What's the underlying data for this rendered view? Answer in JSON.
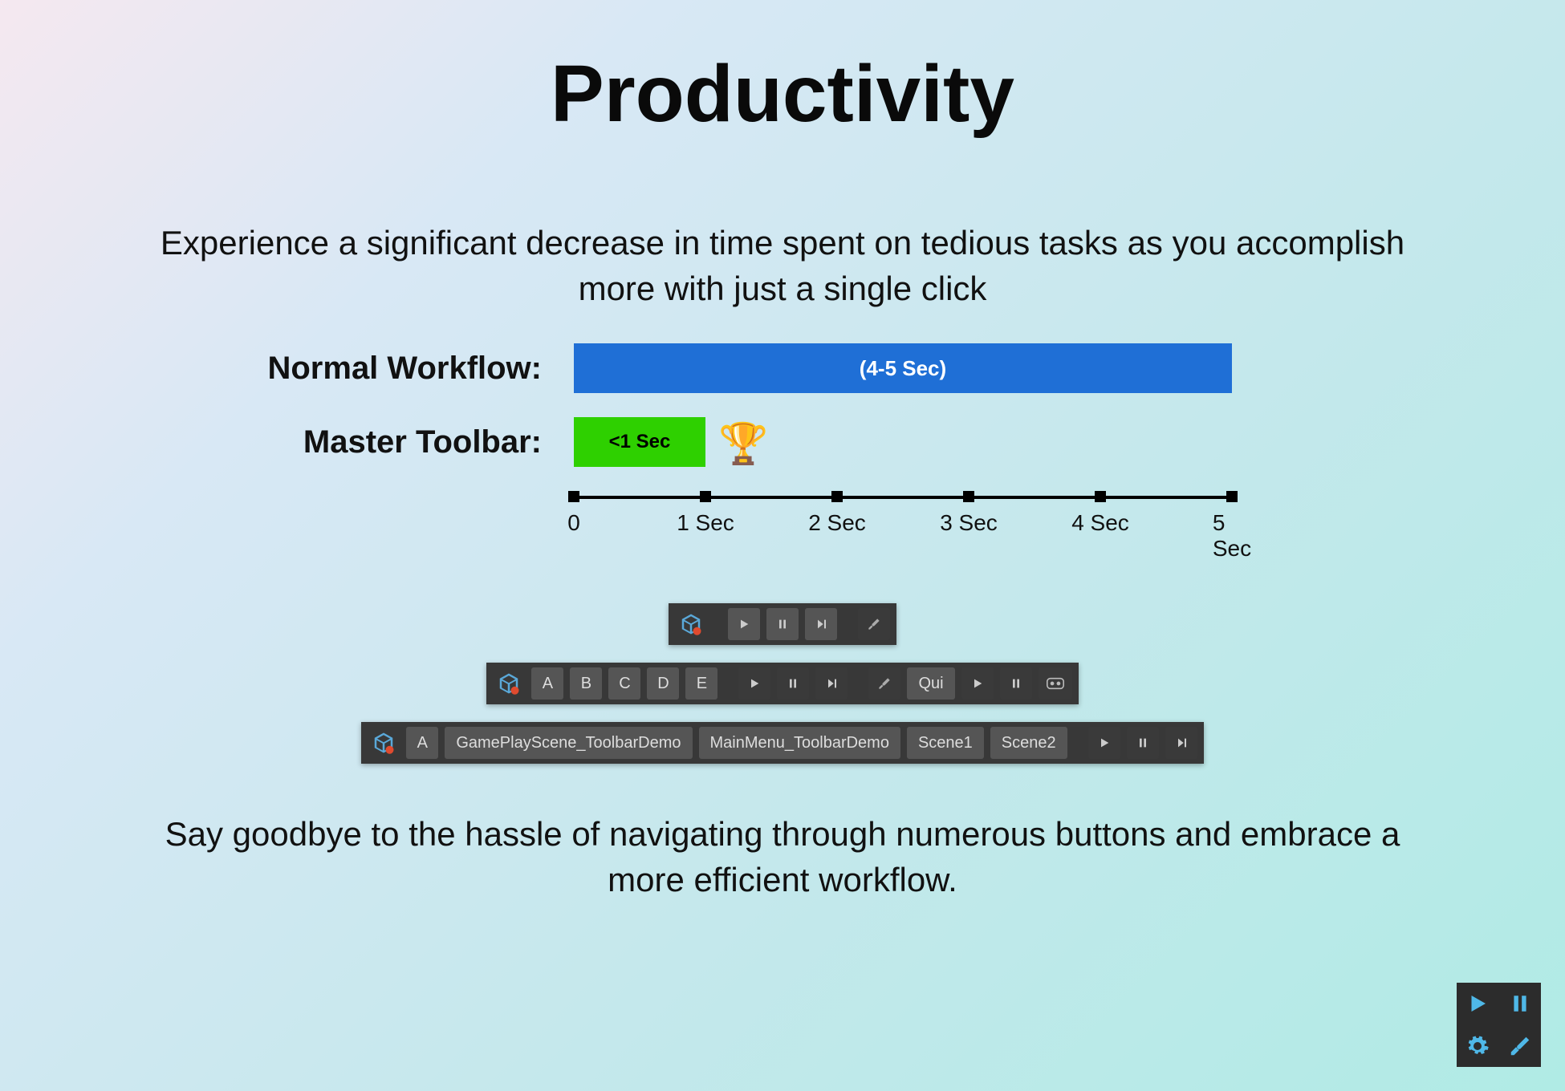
{
  "title": "Productivity",
  "subtitle": "Experience a significant decrease in time spent on tedious tasks as you accomplish more with just a single click",
  "footer": "Say goodbye to the hassle of navigating through numerous buttons and embrace a more efficient workflow.",
  "chart_data": {
    "type": "bar",
    "orientation": "horizontal",
    "title": "",
    "xlabel": "",
    "ylabel": "",
    "x_ticks": [
      "0",
      "1 Sec",
      "2 Sec",
      "3 Sec",
      "4 Sec",
      "5 Sec"
    ],
    "xlim": [
      0,
      5
    ],
    "series": [
      {
        "name": "Normal Workflow:",
        "value": 5,
        "bar_label": "(4-5 Sec)",
        "color": "#1f6fd6"
      },
      {
        "name": "Master Toolbar:",
        "value": 1,
        "bar_label": "<1 Sec",
        "color": "#2ed000",
        "annotation": "🏆"
      }
    ]
  },
  "toolbars": {
    "row1": {
      "letter_buttons": [
        "A",
        "B",
        "C",
        "D",
        "E"
      ],
      "text_button": "Qui"
    },
    "row2": {
      "letter_button": "A",
      "scene_buttons": [
        "GamePlayScene_ToolbarDemo",
        "MainMenu_ToolbarDemo",
        "Scene1",
        "Scene2"
      ]
    }
  },
  "corner_icons": [
    "play",
    "pause",
    "gear",
    "tools"
  ]
}
